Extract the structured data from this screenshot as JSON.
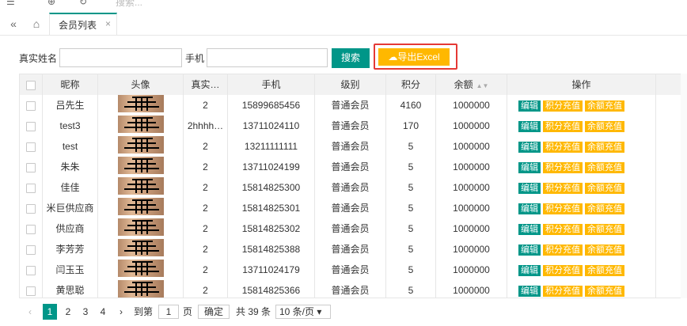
{
  "topbar": {
    "search_hint": "搜索..."
  },
  "tabs": [
    {
      "label": "会员列表",
      "close": "×"
    }
  ],
  "search": {
    "realname_label": "真实姓名",
    "realname_value": "",
    "phone_label": "手机",
    "phone_value": "",
    "search_button": "搜索",
    "export_button": "导出Excel"
  },
  "table": {
    "columns": [
      "昵称",
      "头像",
      "真实…",
      "手机",
      "级别",
      "积分",
      "余额",
      "操作"
    ],
    "rows": [
      {
        "nickname": "吕先生",
        "real": "2",
        "phone": "15899685456",
        "level": "普通会员",
        "points": "4160",
        "balance": "1000000"
      },
      {
        "nickname": "test3",
        "real": "2hhhh…",
        "phone": "13711024110",
        "level": "普通会员",
        "points": "170",
        "balance": "1000000"
      },
      {
        "nickname": "test",
        "real": "2",
        "phone": "13211111111",
        "level": "普通会员",
        "points": "5",
        "balance": "1000000"
      },
      {
        "nickname": "朱朱",
        "real": "2",
        "phone": "13711024199",
        "level": "普通会员",
        "points": "5",
        "balance": "1000000"
      },
      {
        "nickname": "佳佳",
        "real": "2",
        "phone": "15814825300",
        "level": "普通会员",
        "points": "5",
        "balance": "1000000"
      },
      {
        "nickname": "米巨供应商",
        "real": "2",
        "phone": "15814825301",
        "level": "普通会员",
        "points": "5",
        "balance": "1000000"
      },
      {
        "nickname": "供应商",
        "real": "2",
        "phone": "15814825302",
        "level": "普通会员",
        "points": "5",
        "balance": "1000000"
      },
      {
        "nickname": "李芳芳",
        "real": "2",
        "phone": "15814825388",
        "level": "普通会员",
        "points": "5",
        "balance": "1000000"
      },
      {
        "nickname": "闫玉玉",
        "real": "2",
        "phone": "13711024179",
        "level": "普通会员",
        "points": "5",
        "balance": "1000000"
      },
      {
        "nickname": "黄思聪",
        "real": "2",
        "phone": "15814825366",
        "level": "普通会员",
        "points": "5",
        "balance": "1000000"
      }
    ],
    "actions": [
      "编辑",
      "积分充值",
      "余额充值"
    ]
  },
  "pager": {
    "prev": "‹",
    "pages": [
      "1",
      "2",
      "3",
      "4"
    ],
    "next": "›",
    "goto_label": "到第",
    "goto_value": "1",
    "page_unit": "页",
    "confirm": "确定",
    "total": "共 39 条",
    "page_size": "10 条/页"
  },
  "colors": {
    "primary": "#009688",
    "warn": "#FFB800",
    "highlight": "#e53935"
  }
}
